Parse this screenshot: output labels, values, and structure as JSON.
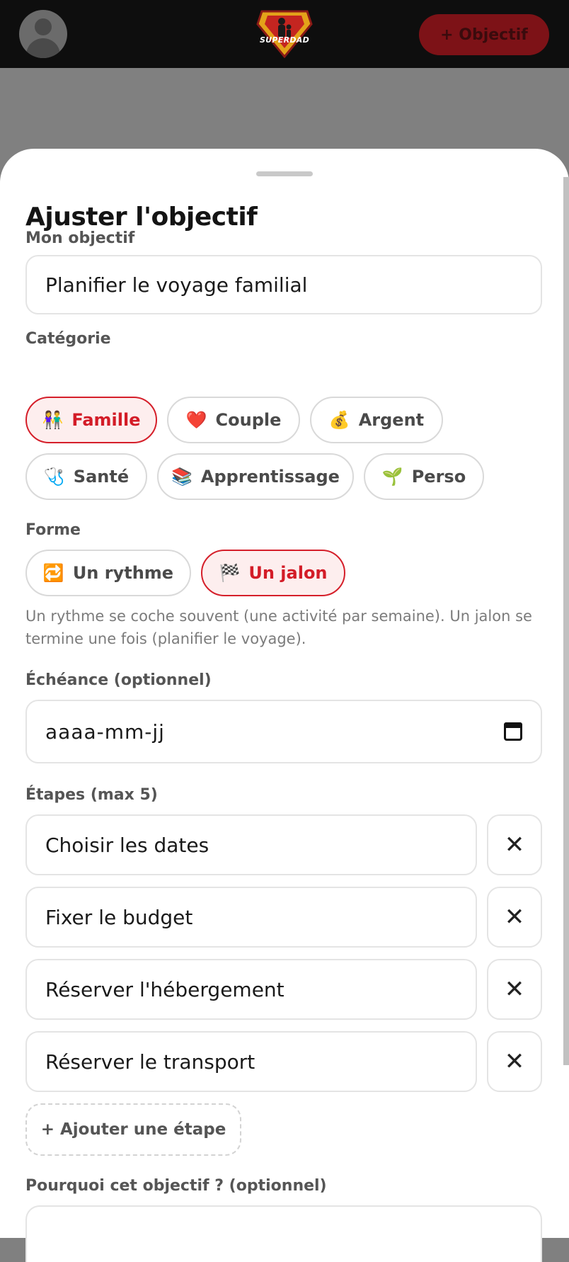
{
  "header": {
    "logo_text": "SUPERDAD",
    "add_button": "+ Objectif",
    "brand_color": "#7d1217"
  },
  "sheet": {
    "title": "Ajuster l'objectif",
    "objective": {
      "label": "Mon objectif",
      "value": "Planifier le voyage familial"
    },
    "category": {
      "label": "Catégorie",
      "options": [
        {
          "icon": "👫",
          "label": "Famille",
          "selected": true
        },
        {
          "icon": "❤️",
          "label": "Couple",
          "selected": false
        },
        {
          "icon": "💰",
          "label": "Argent",
          "selected": false
        },
        {
          "icon": "🩺",
          "label": "Santé",
          "selected": false
        },
        {
          "icon": "📚",
          "label": "Apprentissage",
          "selected": false
        },
        {
          "icon": "🌱",
          "label": "Perso",
          "selected": false
        }
      ]
    },
    "form": {
      "label": "Forme",
      "options": [
        {
          "icon": "🔁",
          "label": "Un rythme",
          "selected": false
        },
        {
          "icon": "🏁",
          "label": "Un jalon",
          "selected": true
        }
      ],
      "hint": "Un rythme se coche souvent (une activité par semaine). Un jalon se termine une fois (planifier le voyage)."
    },
    "deadline": {
      "label": "Échéance (optionnel)",
      "placeholder": "aaaa-mm-jj"
    },
    "steps": {
      "label": "Étapes (max 5)",
      "items": [
        "Choisir les dates",
        "Fixer le budget",
        "Réserver l'hébergement",
        "Réserver le transport"
      ],
      "remove_glyph": "✕",
      "add_label": "+ Ajouter une étape"
    },
    "why": {
      "label": "Pourquoi cet objectif ? (optionnel)"
    },
    "accent_color": "#d31c27"
  }
}
